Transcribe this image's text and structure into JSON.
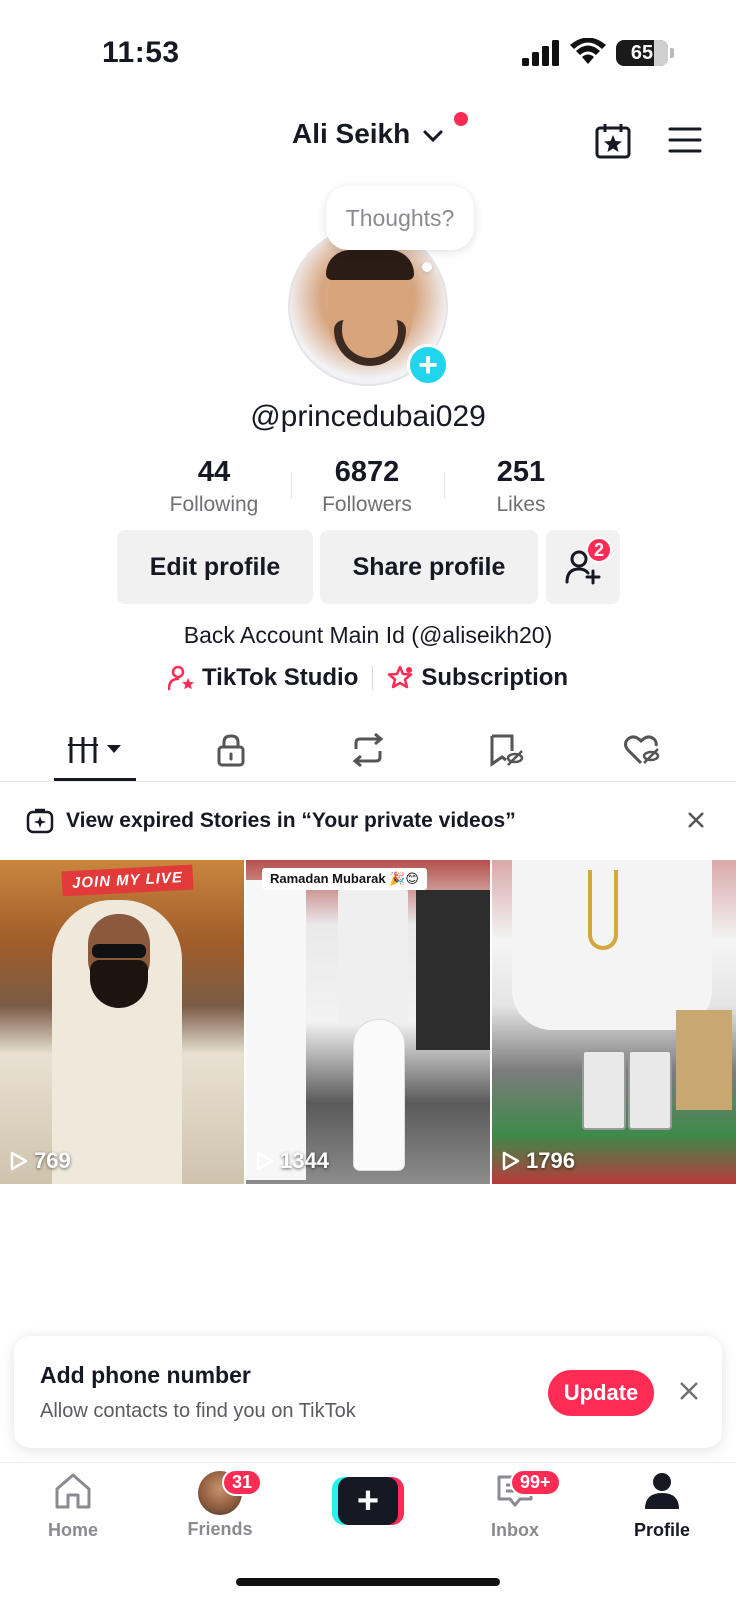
{
  "status_bar": {
    "time": "11:53",
    "battery": "65"
  },
  "header": {
    "name": "Ali Seikh"
  },
  "thought_bubble": "Thoughts?",
  "profile": {
    "username": "@princedubai029",
    "stats": [
      {
        "value": "44",
        "label": "Following"
      },
      {
        "value": "6872",
        "label": "Followers"
      },
      {
        "value": "251",
        "label": "Likes"
      }
    ],
    "edit_label": "Edit profile",
    "share_label": "Share profile",
    "friend_requests": "2",
    "bio": "Back Account Main Id (@aliseikh20)",
    "links": {
      "studio": "TikTok Studio",
      "subscription": "Subscription"
    }
  },
  "tabs": [
    "videos-grid",
    "private",
    "reposts",
    "favorites",
    "liked"
  ],
  "expired_stories": {
    "text": "View expired Stories in “Your private videos”"
  },
  "videos": [
    {
      "views": "769",
      "overlay": "JOIN MY LIVE"
    },
    {
      "views": "1344",
      "overlay": "Ramadan Mubarak 🎉😊"
    },
    {
      "views": "1796",
      "overlay": ""
    }
  ],
  "phone_prompt": {
    "title": "Add phone number",
    "subtitle": "Allow contacts to find you on TikTok",
    "button": "Update"
  },
  "nav": {
    "home": "Home",
    "friends": "Friends",
    "friends_badge": "31",
    "inbox": "Inbox",
    "inbox_badge": "99+",
    "profile": "Profile"
  },
  "colors": {
    "accent": "#fe2c55",
    "cyan": "#20d5ec",
    "text": "#161823"
  }
}
